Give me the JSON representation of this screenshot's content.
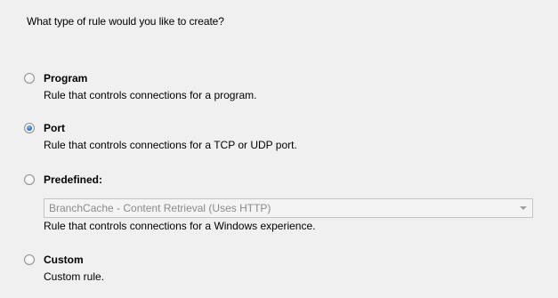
{
  "question": "What type of rule would you like to create?",
  "options": [
    {
      "label": "Program",
      "description": "Rule that controls connections for a program.",
      "checked": false
    },
    {
      "label": "Port",
      "description": "Rule that controls connections for a TCP or UDP port.",
      "checked": true
    },
    {
      "label": "Predefined:",
      "description": "Rule that controls connections for a Windows experience.",
      "checked": false
    },
    {
      "label": "Custom",
      "description": "Custom rule.",
      "checked": false
    }
  ],
  "predefined_select": {
    "value": "BranchCache - Content Retrieval (Uses HTTP)",
    "disabled": true
  }
}
